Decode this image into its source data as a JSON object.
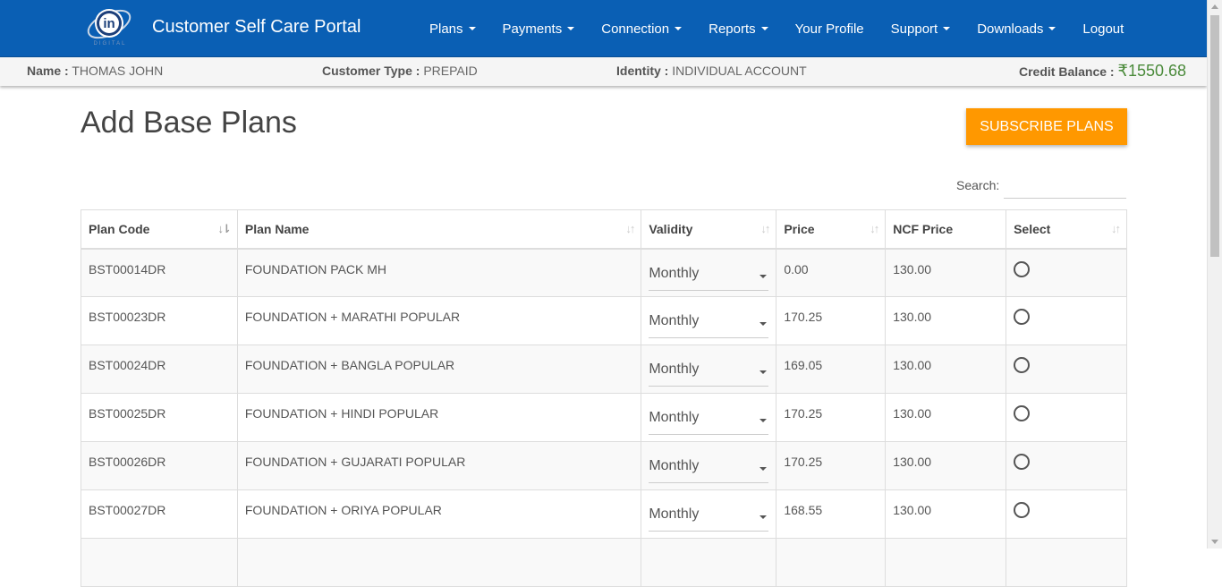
{
  "app": {
    "title": "Customer Self Care Portal",
    "logo_icon": "in-digital-globe-logo"
  },
  "nav": {
    "items": [
      {
        "label": "Plans",
        "dropdown": true
      },
      {
        "label": "Payments",
        "dropdown": true
      },
      {
        "label": "Connection",
        "dropdown": true
      },
      {
        "label": "Reports",
        "dropdown": true
      },
      {
        "label": "Your Profile",
        "dropdown": false
      },
      {
        "label": "Support",
        "dropdown": true
      },
      {
        "label": "Downloads",
        "dropdown": true
      },
      {
        "label": "Logout",
        "dropdown": false
      }
    ]
  },
  "customer": {
    "name_label": "Name :",
    "name": "THOMAS JOHN",
    "type_label": "Customer Type :",
    "type": "PREPAID",
    "identity_label": "Identity :",
    "identity": "INDIVIDUAL ACCOUNT",
    "credit_label": "Credit Balance :",
    "credit_currency": "₹",
    "credit_value": "1550.68"
  },
  "page": {
    "title": "Add Base Plans",
    "subscribe_label": "SUBSCRIBE PLANS",
    "search_label": "Search:",
    "search_value": ""
  },
  "table": {
    "headers": [
      "Plan Code",
      "Plan Name",
      "Validity",
      "Price",
      "NCF Price",
      "Select"
    ],
    "rows": [
      {
        "code": "BST00014DR",
        "name": "FOUNDATION PACK MH",
        "validity": "Monthly",
        "price": "0.00",
        "ncf": "130.00",
        "selected": false
      },
      {
        "code": "BST00023DR",
        "name": "FOUNDATION + MARATHI POPULAR",
        "validity": "Monthly",
        "price": "170.25",
        "ncf": "130.00",
        "selected": false
      },
      {
        "code": "BST00024DR",
        "name": "FOUNDATION + BANGLA POPULAR",
        "validity": "Monthly",
        "price": "169.05",
        "ncf": "130.00",
        "selected": false
      },
      {
        "code": "BST00025DR",
        "name": "FOUNDATION + HINDI POPULAR",
        "validity": "Monthly",
        "price": "170.25",
        "ncf": "130.00",
        "selected": false
      },
      {
        "code": "BST00026DR",
        "name": "FOUNDATION + GUJARATI POPULAR",
        "validity": "Monthly",
        "price": "170.25",
        "ncf": "130.00",
        "selected": false
      },
      {
        "code": "BST00027DR",
        "name": "FOUNDATION + ORIYA POPULAR",
        "validity": "Monthly",
        "price": "168.55",
        "ncf": "130.00",
        "selected": false
      }
    ]
  },
  "colors": {
    "navbar": "#0a5fb4",
    "accent_button": "#ff9800",
    "credit_text": "#4a8a3a"
  }
}
